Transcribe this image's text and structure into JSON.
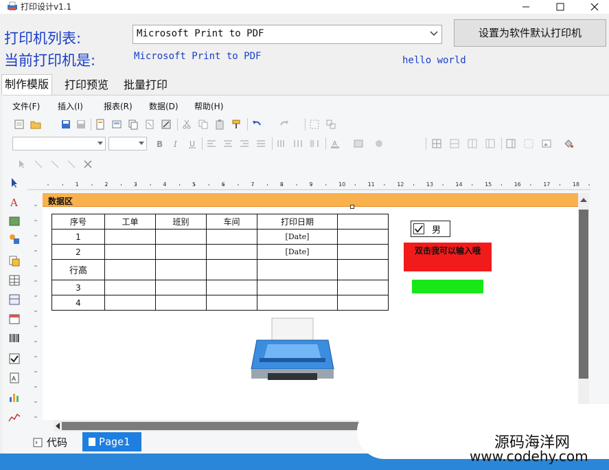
{
  "window": {
    "title": "打印设计v1.1"
  },
  "printer": {
    "list_label": "打印机列表:",
    "current_label": "当前打印机是:",
    "selected": "Microsoft Print to PDF",
    "current_value": "Microsoft Print to PDF",
    "set_default_label": "设置为软件默认打印机",
    "greeting": "hello world"
  },
  "tabs": [
    "制作模版",
    "打印预览",
    "批量打印"
  ],
  "menu": [
    "文件(F)",
    "插入(I)",
    "报表(R)",
    "数据(D)",
    "帮助(H)"
  ],
  "ruler": [
    "1",
    "2",
    "3",
    "4",
    "5",
    "6",
    "7",
    "8",
    "9",
    "10",
    "11",
    "12",
    "13",
    "14",
    "15",
    "16",
    "17",
    "18"
  ],
  "band": {
    "label": "数据区"
  },
  "table": {
    "headers": [
      "序号",
      "工单",
      "班别",
      "车间",
      "打印日期"
    ],
    "rows": [
      [
        "1",
        "",
        "",
        "",
        "[Date]",
        ""
      ],
      [
        "2",
        "",
        "",
        "",
        "[Date]",
        ""
      ],
      [
        "行高",
        "",
        "",
        "",
        "",
        ""
      ],
      [
        "3",
        "",
        "",
        "",
        "",
        ""
      ],
      [
        "4",
        "",
        "",
        "",
        "",
        ""
      ]
    ]
  },
  "checkbox": {
    "label": "男",
    "checked": true
  },
  "red_box": {
    "text": "双击我可以输入哦"
  },
  "bottom_tabs": {
    "code": "代码",
    "page": "Page1"
  },
  "watermark": {
    "line1": "源码海洋网",
    "line2": "www.codehy.com"
  },
  "colors": {
    "accent_blue": "#1a3fc8",
    "band": "#f9b14e",
    "status": "#2a86d8",
    "red": "#f21b1b",
    "green": "#18e818"
  }
}
